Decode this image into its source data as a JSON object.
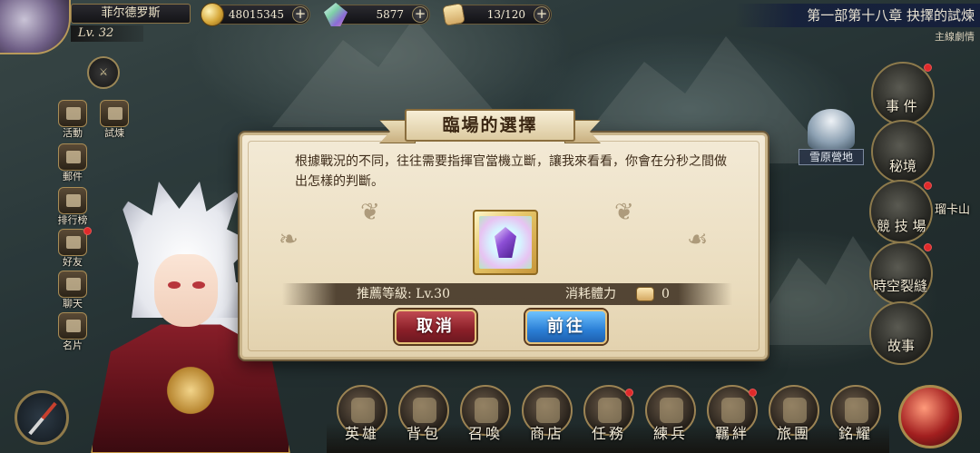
{
  "player": {
    "name": "菲尔德罗斯",
    "level": "Lv. 32"
  },
  "resources": {
    "gold": "48015345",
    "gems": "5877",
    "stamina": "13/120"
  },
  "chapter": {
    "title": "第一部第十八章 抉擇的試煉",
    "subtitle": "主線劇情"
  },
  "left_menu": [
    {
      "label": "活動"
    },
    {
      "label": "試煉"
    },
    {
      "label": "郵件"
    },
    {
      "label": "排行榜"
    },
    {
      "label": "好友"
    },
    {
      "label": "聊天"
    },
    {
      "label": "名片"
    }
  ],
  "right_menu": [
    {
      "label": "事 件"
    },
    {
      "label": "秘境"
    },
    {
      "label": "競 技 場"
    },
    {
      "label": "時空裂縫"
    },
    {
      "label": "故事"
    }
  ],
  "map": {
    "snow_camp": "雪原營地",
    "side_label": "瑠卡山"
  },
  "bottom_nav": [
    {
      "label": "英雄"
    },
    {
      "label": "背包"
    },
    {
      "label": "召喚"
    },
    {
      "label": "商店"
    },
    {
      "label": "任務"
    },
    {
      "label": "練兵"
    },
    {
      "label": "羈絆"
    },
    {
      "label": "旅團"
    },
    {
      "label": "銘耀"
    }
  ],
  "dialog": {
    "title": "臨場的選擇",
    "description": "根據戰況的不同，往往需要指揮官當機立斷，讓我來看看，你會在分秒之間做出怎樣的判斷。",
    "recommended_level": "推薦等級: Lv.30",
    "stamina_cost_label": "消耗體力",
    "stamina_cost_value": "0",
    "cancel_label": "取消",
    "go_label": "前往"
  },
  "icons": {
    "compass": "compass-icon",
    "crystal": "purple-crystal-icon",
    "stamina": "bread-stamina-icon",
    "gold": "gold-coin-icon",
    "gem": "gem-icon"
  },
  "colors": {
    "cancel_button": "#8a1f28",
    "go_button": "#2b7fd6",
    "dialog_bg": "#eadcbd",
    "notification_dot": "#e02a2a"
  }
}
